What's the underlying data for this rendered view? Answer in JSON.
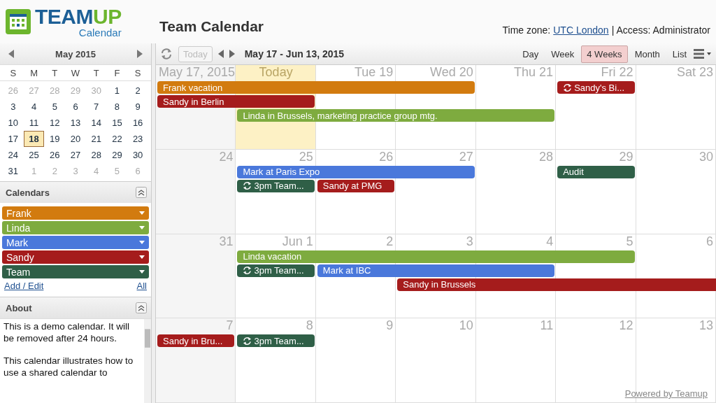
{
  "header": {
    "brand_parts": [
      "TEAM",
      "UP"
    ],
    "brand_sub": "Calendar",
    "title": "Team Calendar",
    "timezone_label": "Time zone:",
    "timezone": "UTC London",
    "access": "| Access: Administrator"
  },
  "mini_calendar": {
    "month": "May 2015",
    "weekdays": [
      "S",
      "M",
      "T",
      "W",
      "T",
      "F",
      "S"
    ],
    "weeks": [
      [
        {
          "day": "26",
          "other_month": true,
          "selected": false
        },
        {
          "day": "27",
          "other_month": true,
          "selected": false
        },
        {
          "day": "28",
          "other_month": true,
          "selected": false
        },
        {
          "day": "29",
          "other_month": true,
          "selected": false
        },
        {
          "day": "30",
          "other_month": true,
          "selected": false
        },
        {
          "day": "1",
          "other_month": false,
          "selected": false
        },
        {
          "day": "2",
          "other_month": false,
          "selected": false
        }
      ],
      [
        {
          "day": "3",
          "other_month": false,
          "selected": false
        },
        {
          "day": "4",
          "other_month": false,
          "selected": false
        },
        {
          "day": "5",
          "other_month": false,
          "selected": false
        },
        {
          "day": "6",
          "other_month": false,
          "selected": false
        },
        {
          "day": "7",
          "other_month": false,
          "selected": false
        },
        {
          "day": "8",
          "other_month": false,
          "selected": false
        },
        {
          "day": "9",
          "other_month": false,
          "selected": false
        }
      ],
      [
        {
          "day": "10",
          "other_month": false,
          "selected": false
        },
        {
          "day": "11",
          "other_month": false,
          "selected": false
        },
        {
          "day": "12",
          "other_month": false,
          "selected": false
        },
        {
          "day": "13",
          "other_month": false,
          "selected": false
        },
        {
          "day": "14",
          "other_month": false,
          "selected": false
        },
        {
          "day": "15",
          "other_month": false,
          "selected": false
        },
        {
          "day": "16",
          "other_month": false,
          "selected": false
        }
      ],
      [
        {
          "day": "17",
          "other_month": false,
          "selected": false
        },
        {
          "day": "18",
          "other_month": false,
          "selected": true
        },
        {
          "day": "19",
          "other_month": false,
          "selected": false
        },
        {
          "day": "20",
          "other_month": false,
          "selected": false
        },
        {
          "day": "21",
          "other_month": false,
          "selected": false
        },
        {
          "day": "22",
          "other_month": false,
          "selected": false
        },
        {
          "day": "23",
          "other_month": false,
          "selected": false
        }
      ],
      [
        {
          "day": "24",
          "other_month": false,
          "selected": false
        },
        {
          "day": "25",
          "other_month": false,
          "selected": false
        },
        {
          "day": "26",
          "other_month": false,
          "selected": false
        },
        {
          "day": "27",
          "other_month": false,
          "selected": false
        },
        {
          "day": "28",
          "other_month": false,
          "selected": false
        },
        {
          "day": "29",
          "other_month": false,
          "selected": false
        },
        {
          "day": "30",
          "other_month": false,
          "selected": false
        }
      ],
      [
        {
          "day": "31",
          "other_month": false,
          "selected": false
        },
        {
          "day": "1",
          "other_month": true,
          "selected": false
        },
        {
          "day": "2",
          "other_month": true,
          "selected": false
        },
        {
          "day": "3",
          "other_month": true,
          "selected": false
        },
        {
          "day": "4",
          "other_month": true,
          "selected": false
        },
        {
          "day": "5",
          "other_month": true,
          "selected": false
        },
        {
          "day": "6",
          "other_month": true,
          "selected": false
        }
      ]
    ]
  },
  "calendars": {
    "title": "Calendars",
    "items": [
      {
        "name": "Frank",
        "color": "#d27b0f"
      },
      {
        "name": "Linda",
        "color": "#7eab3f"
      },
      {
        "name": "Mark",
        "color": "#4a78db"
      },
      {
        "name": "Sandy",
        "color": "#a51c1c"
      },
      {
        "name": "Team",
        "color": "#2f5f47"
      }
    ],
    "add_edit": "Add / Edit",
    "all": "All"
  },
  "about": {
    "title": "About",
    "paragraphs": [
      "This is a demo calendar. It will be removed after 24 hours.",
      "This calendar illustrates how to use a shared calendar to"
    ]
  },
  "toolbar": {
    "today": {
      "label": "Today",
      "disabled": true
    },
    "range": "May 17 - Jun 13, 2015",
    "views": [
      {
        "label": "Day",
        "selected": false
      },
      {
        "label": "Week",
        "selected": false
      },
      {
        "label": "4 Weeks",
        "selected": true
      },
      {
        "label": "Month",
        "selected": false
      },
      {
        "label": "List",
        "selected": false
      }
    ]
  },
  "weeks": [
    {
      "days": [
        {
          "label": "May 17, 2015",
          "today": false
        },
        {
          "label": "Today",
          "today": true
        },
        {
          "label": "Tue 19",
          "today": false
        },
        {
          "label": "Wed 20",
          "today": false
        },
        {
          "label": "Thu 21",
          "today": false
        },
        {
          "label": "Fri 22",
          "today": false
        },
        {
          "label": "Sat 23",
          "today": false
        }
      ],
      "events": [
        {
          "title": "Frank vacation",
          "color": "#d27b0f",
          "recurring": false,
          "continues": false
        },
        {
          "title": "Sandy's Bi...",
          "color": "#a51c1c",
          "recurring": true,
          "continues": false
        },
        {
          "title": "Sandy in Berlin",
          "color": "#a51c1c",
          "recurring": false,
          "continues": false
        },
        {
          "title": "Linda in Brussels, marketing practice group mtg.",
          "color": "#7eab3f",
          "recurring": false,
          "continues": false
        }
      ]
    },
    {
      "days": [
        {
          "label": "24",
          "today": false
        },
        {
          "label": "25",
          "today": false
        },
        {
          "label": "26",
          "today": false
        },
        {
          "label": "27",
          "today": false
        },
        {
          "label": "28",
          "today": false
        },
        {
          "label": "29",
          "today": false
        },
        {
          "label": "30",
          "today": false
        }
      ],
      "events": [
        {
          "title": "Mark at Paris Expo",
          "color": "#4a78db",
          "recurring": false,
          "continues": false
        },
        {
          "title": "Audit",
          "color": "#2f5f47",
          "recurring": false,
          "continues": false
        },
        {
          "title": "3pm Team...",
          "color": "#2f5f47",
          "recurring": true,
          "continues": false
        },
        {
          "title": "Sandy at PMG",
          "color": "#a51c1c",
          "recurring": false,
          "continues": false
        }
      ]
    },
    {
      "days": [
        {
          "label": "31",
          "today": false
        },
        {
          "label": "Jun 1",
          "today": false
        },
        {
          "label": "2",
          "today": false
        },
        {
          "label": "3",
          "today": false
        },
        {
          "label": "4",
          "today": false
        },
        {
          "label": "5",
          "today": false
        },
        {
          "label": "6",
          "today": false
        }
      ],
      "events": [
        {
          "title": "Linda vacation",
          "color": "#7eab3f",
          "recurring": false,
          "continues": false
        },
        {
          "title": "3pm Team...",
          "color": "#2f5f47",
          "recurring": true,
          "continues": false
        },
        {
          "title": "Mark at IBC",
          "color": "#4a78db",
          "recurring": false,
          "continues": false
        },
        {
          "title": "Sandy in Brussels",
          "color": "#a51c1c",
          "recurring": false,
          "continues": true
        }
      ]
    },
    {
      "days": [
        {
          "label": "7",
          "today": false
        },
        {
          "label": "8",
          "today": false
        },
        {
          "label": "9",
          "today": false
        },
        {
          "label": "10",
          "today": false
        },
        {
          "label": "11",
          "today": false
        },
        {
          "label": "12",
          "today": false
        },
        {
          "label": "13",
          "today": false
        }
      ],
      "events": [
        {
          "title": "Sandy in Bru...",
          "color": "#a51c1c",
          "recurring": false,
          "continues": false
        },
        {
          "title": "3pm Team...",
          "color": "#2f5f47",
          "recurring": true,
          "continues": false
        }
      ]
    }
  ],
  "footer": {
    "powered_by": "Powered by Teamup"
  }
}
